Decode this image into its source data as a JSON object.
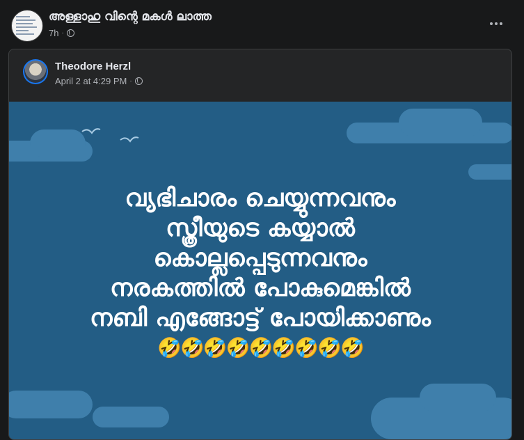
{
  "post": {
    "page_name": "അള്ളാഹു വിന്റെ മകൾ ലാത്ത",
    "time": "7h",
    "separator": "·"
  },
  "shared": {
    "author": "Theodore Herzl",
    "time": "April 2 at 4:29 PM",
    "separator": "·"
  },
  "image_text": {
    "lines": [
      "വ്യഭിചാരം ചെയ്യുന്നവനും",
      "സ്ത്രീയുടെ കയ്യാൽ",
      "കൊല്ലപ്പെടുന്നവനും",
      "നരകത്തിൽ പോകുമെങ്കിൽ",
      "നബി എങ്ങോട്ട് പോയിക്കാണും"
    ],
    "emoji": "🤣🤣🤣🤣🤣🤣🤣🤣🤣"
  },
  "icons": {
    "privacy": "globe-icon",
    "menu": "more-options-icon"
  },
  "colors": {
    "background": "#18191a",
    "card": "#242526",
    "image_bg": "#235d85",
    "cloud": "#3f7fab"
  }
}
